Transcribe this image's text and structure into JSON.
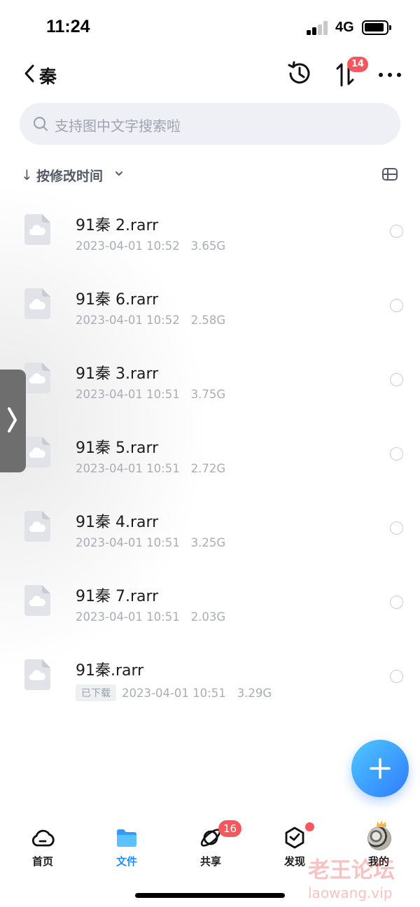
{
  "status_bar": {
    "time": "11:24",
    "network": "4G"
  },
  "header": {
    "title": "秦",
    "transfer_badge": "14"
  },
  "search": {
    "placeholder": "支持图中文字搜索啦"
  },
  "sort": {
    "arrow": "↓",
    "label": "按修改时间"
  },
  "files": [
    {
      "name": "91秦 2.rarr",
      "date": "2023-04-01 10:52",
      "size": "3.65G",
      "downloaded": false
    },
    {
      "name": "91秦 6.rarr",
      "date": "2023-04-01 10:52",
      "size": "2.58G",
      "downloaded": false
    },
    {
      "name": "91秦 3.rarr",
      "date": "2023-04-01 10:51",
      "size": "3.75G",
      "downloaded": false
    },
    {
      "name": "91秦 5.rarr",
      "date": "2023-04-01 10:51",
      "size": "2.72G",
      "downloaded": false
    },
    {
      "name": "91秦 4.rarr",
      "date": "2023-04-01 10:51",
      "size": "3.25G",
      "downloaded": false
    },
    {
      "name": "91秦 7.rarr",
      "date": "2023-04-01 10:51",
      "size": "2.03G",
      "downloaded": false
    },
    {
      "name": "91秦.rarr",
      "date": "2023-04-01 10:51",
      "size": "3.29G",
      "downloaded": true,
      "downloaded_label": "已下载"
    }
  ],
  "bottom_nav": {
    "home": "首页",
    "files": "文件",
    "share": "共享",
    "share_badge": "16",
    "discover": "发现",
    "mine": "我的"
  },
  "watermark": {
    "cn": "老王论坛",
    "en": "laowang.vip"
  },
  "colors": {
    "accent": "#1e8cff",
    "badge": "#f4585e",
    "fab_start": "#4fc8ff",
    "fab_end": "#2f7bff"
  }
}
